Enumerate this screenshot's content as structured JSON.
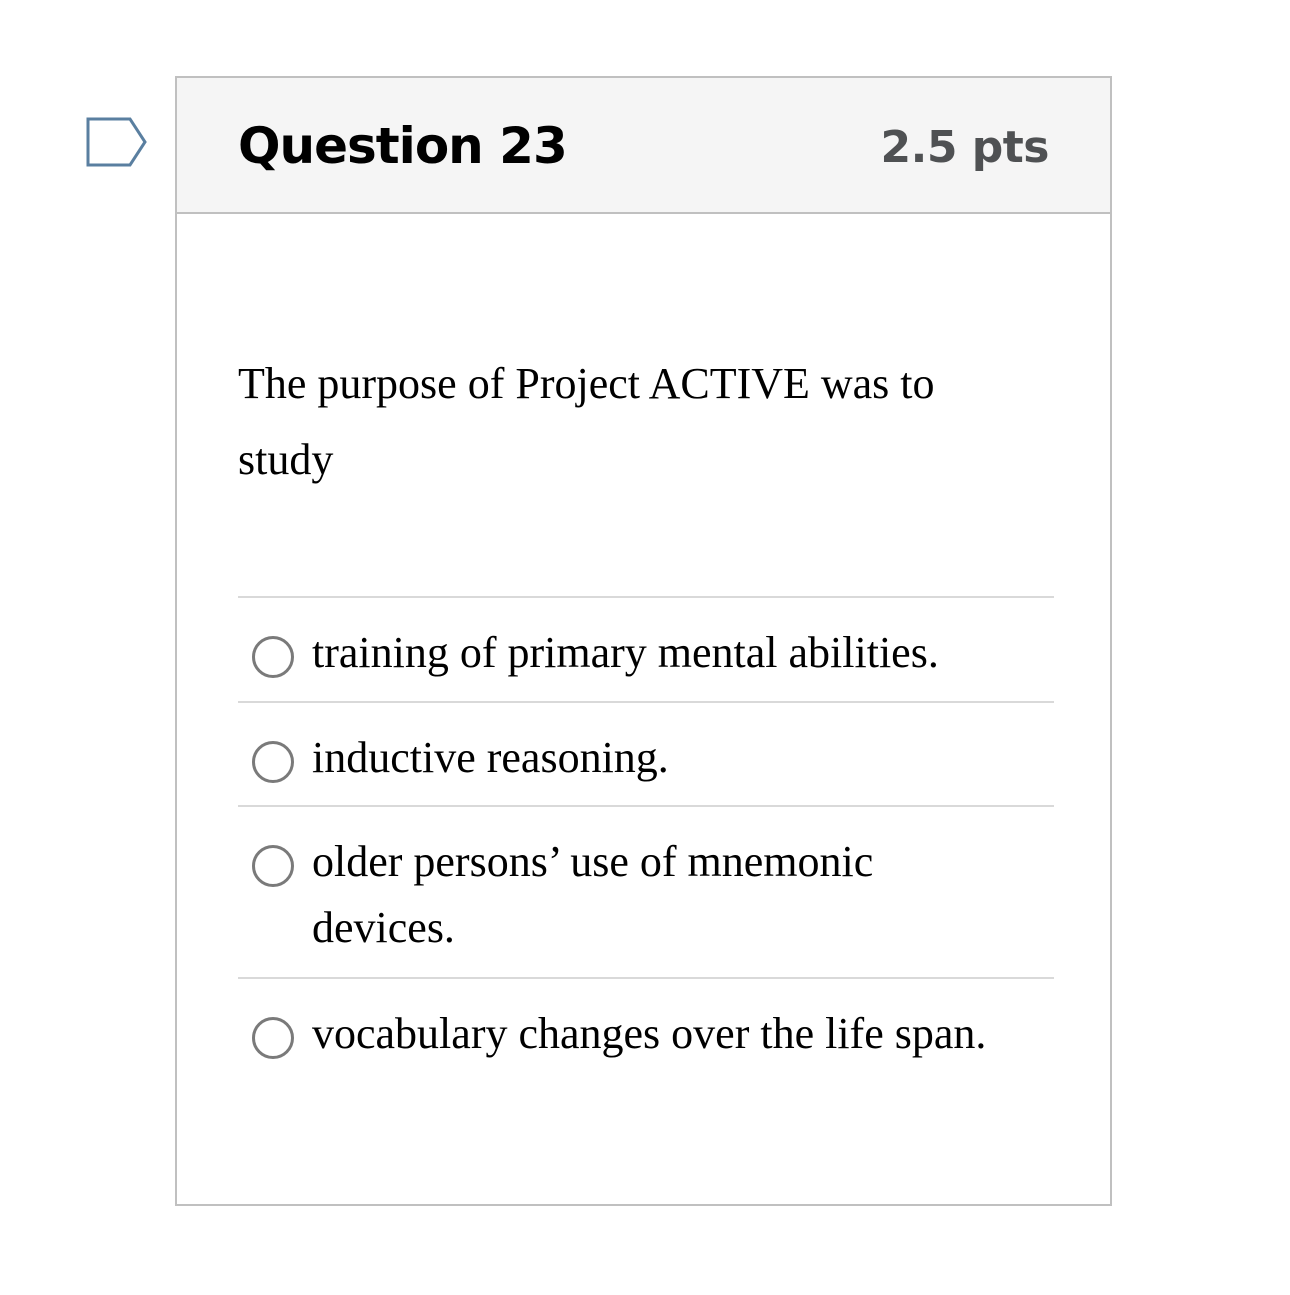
{
  "question": {
    "title": "Question 23",
    "points": "2.5 pts",
    "text": "The purpose of Project ACTIVE was to study",
    "flag_icon": "flag-icon"
  },
  "answers": [
    {
      "label": "training of primary mental abilities.",
      "selected": false
    },
    {
      "label": "inductive reasoning.",
      "selected": false
    },
    {
      "label": "older persons’ use of mnemonic devices.",
      "selected": false
    },
    {
      "label": "vocabulary changes over the life span.",
      "selected": false
    }
  ],
  "colors": {
    "header_bg": "#f5f5f5",
    "border": "#c0c0c0",
    "divider": "#d9d9d9",
    "points_text": "#4f5153",
    "flag_stroke": "#5a7fa0",
    "radio_border": "#7a7a7a"
  }
}
